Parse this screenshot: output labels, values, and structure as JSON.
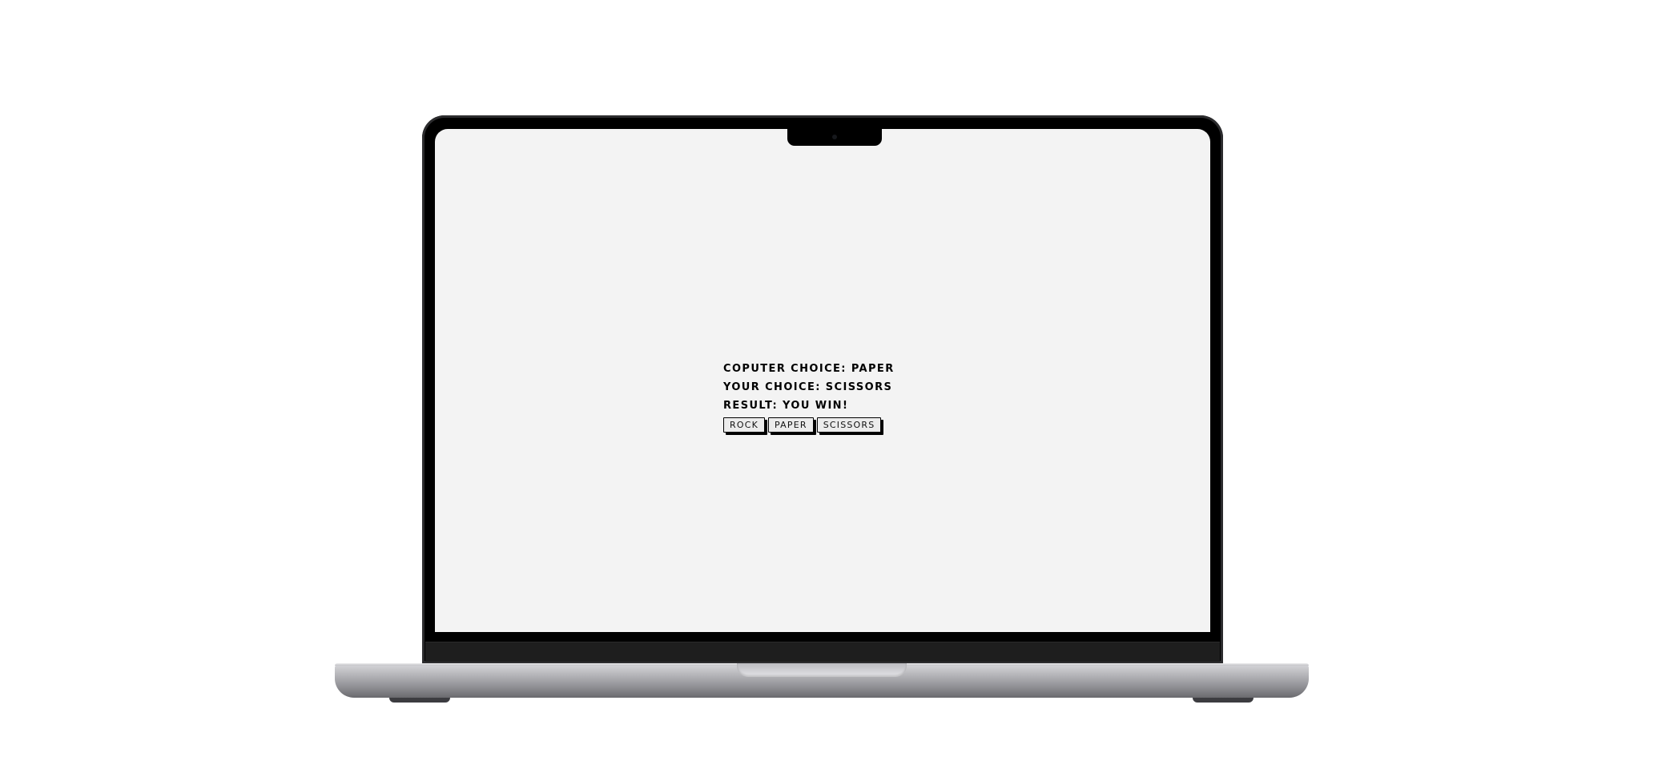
{
  "game": {
    "computer_choice_text": "COPUTER CHOICE: PAPER",
    "your_choice_text": "YOUR CHOICE: SCISSORS",
    "result_text": "RESULT: YOU WIN!",
    "buttons": {
      "rock": "ROCK",
      "paper": "PAPER",
      "scissors": "SCISSORS"
    }
  },
  "colors": {
    "screen_background": "#f3f3f3",
    "text": "#000000",
    "button_background": "#ececec",
    "button_border": "#000000",
    "laptop_bezel": "#000000",
    "laptop_base": "#b4b4b8"
  }
}
